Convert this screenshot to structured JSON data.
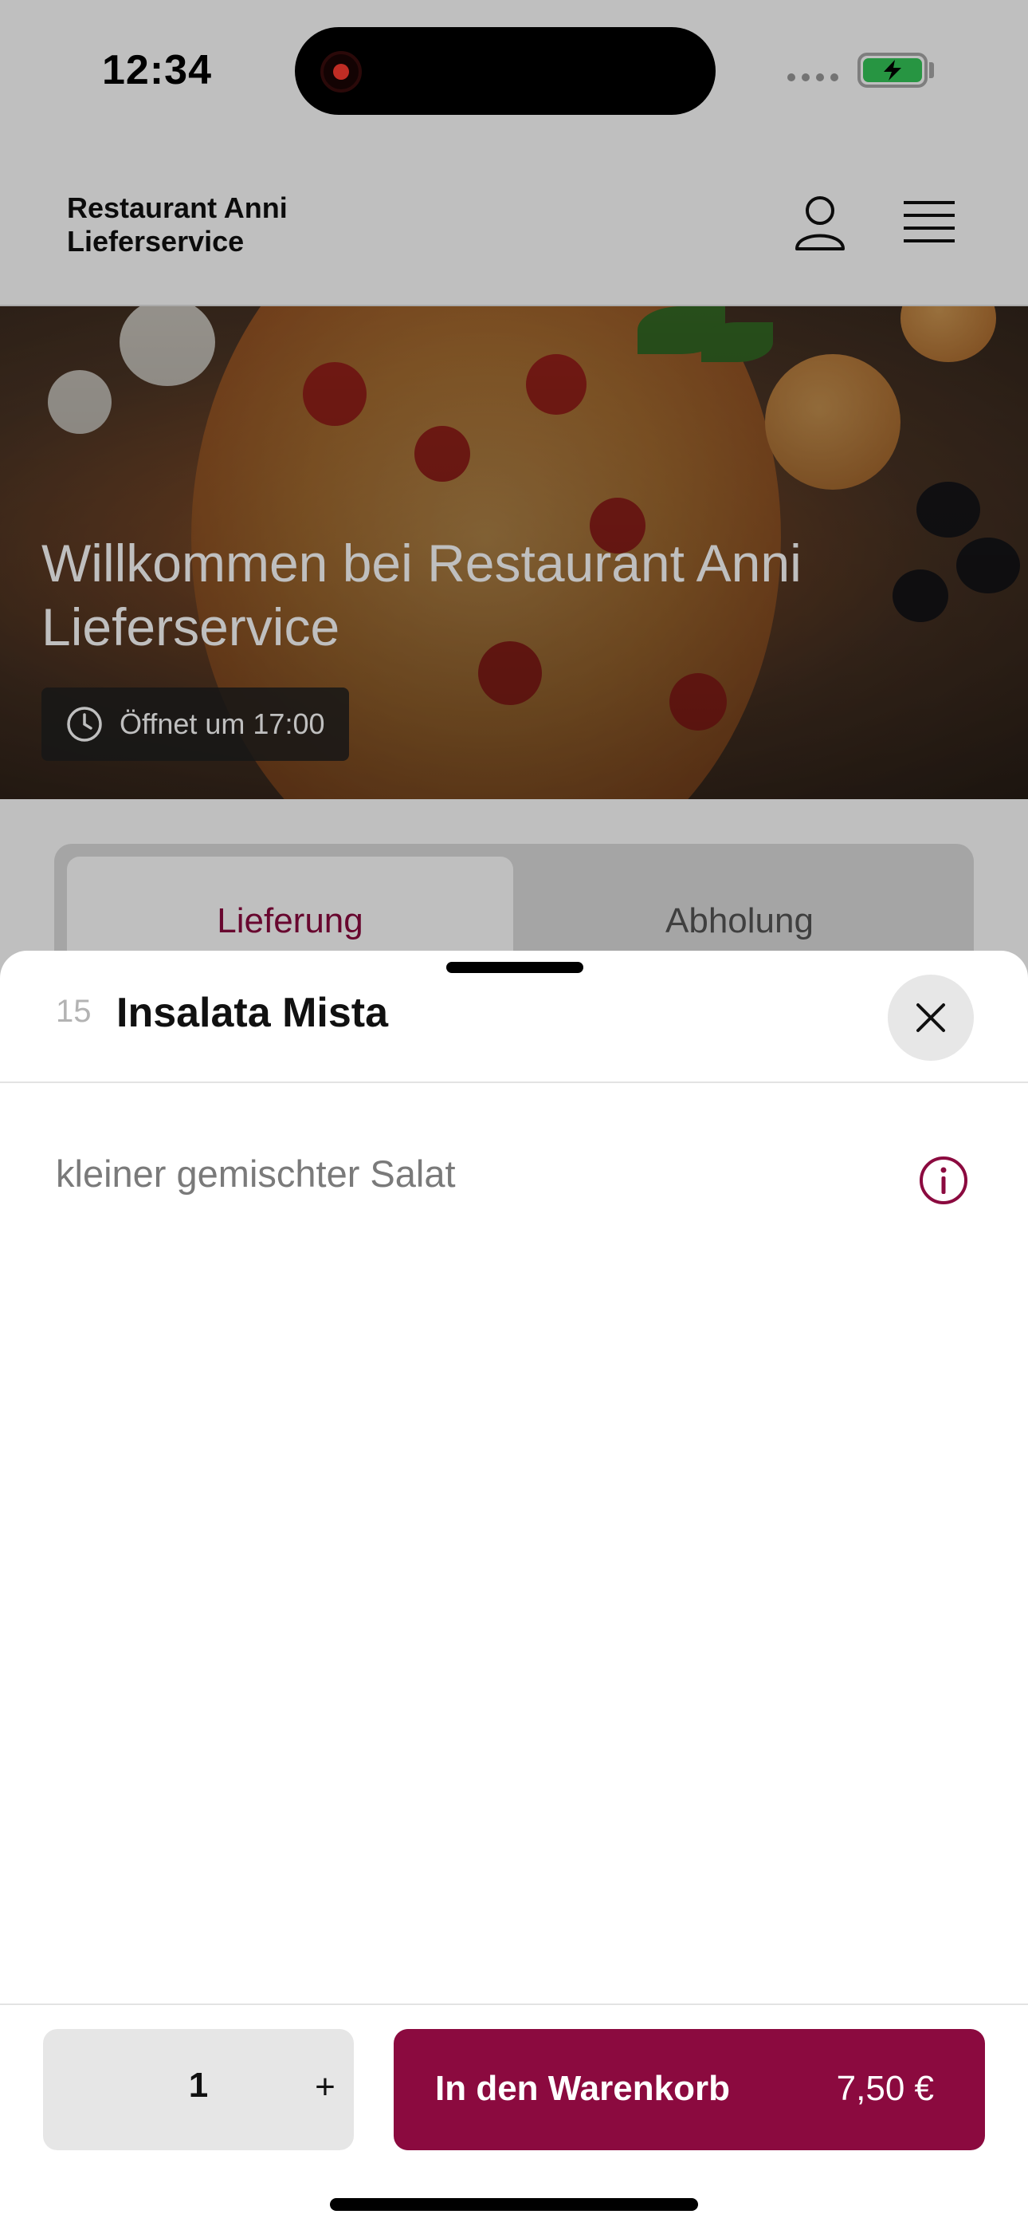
{
  "status_bar": {
    "time": "12:34"
  },
  "header": {
    "brand": "Restaurant Anni Lieferservice"
  },
  "hero": {
    "title": "Willkommen bei Restaurant Anni Lieferservice",
    "hours": "Öffnet um 17:00"
  },
  "tabs": [
    {
      "label": "Lieferung",
      "active": true
    },
    {
      "label": "Abholung",
      "active": false
    }
  ],
  "sheet": {
    "item_number": "15",
    "item_title": "Insalata Mista",
    "description": "kleiner gemischter Salat",
    "quantity": "1",
    "plus_label": "+",
    "cart_label": "In den Warenkorb",
    "price": "7,50 €"
  },
  "colors": {
    "accent": "#8b0a3f",
    "battery": "#34c759"
  },
  "icons": [
    "user-icon",
    "menu-icon",
    "clock-icon",
    "close-icon",
    "info-icon",
    "recording-icon",
    "battery-icon"
  ]
}
